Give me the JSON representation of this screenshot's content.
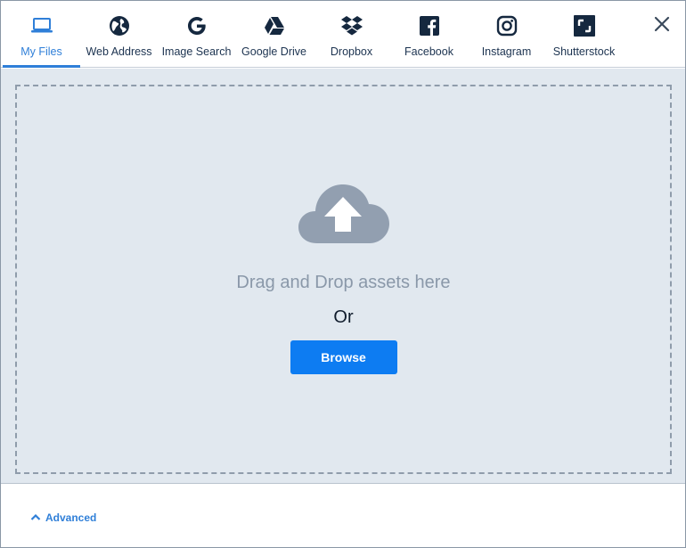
{
  "tabs": [
    {
      "id": "my-files",
      "label": "My Files",
      "icon": "laptop-icon",
      "active": true
    },
    {
      "id": "web-address",
      "label": "Web Address",
      "icon": "globe-icon",
      "active": false
    },
    {
      "id": "image-search",
      "label": "Image Search",
      "icon": "google-icon",
      "active": false
    },
    {
      "id": "google-drive",
      "label": "Google Drive",
      "icon": "google-drive-icon",
      "active": false
    },
    {
      "id": "dropbox",
      "label": "Dropbox",
      "icon": "dropbox-icon",
      "active": false
    },
    {
      "id": "facebook",
      "label": "Facebook",
      "icon": "facebook-icon",
      "active": false
    },
    {
      "id": "instagram",
      "label": "Instagram",
      "icon": "instagram-icon",
      "active": false
    },
    {
      "id": "shutterstock",
      "label": "Shutterstock",
      "icon": "shutterstock-icon",
      "active": false
    }
  ],
  "dropzone": {
    "icon": "cloud-upload-icon",
    "prompt": "Drag and Drop assets here",
    "or_text": "Or",
    "browse_label": "Browse"
  },
  "footer": {
    "advanced_label": "Advanced",
    "advanced_icon": "chevron-up-icon"
  },
  "colors": {
    "accent": "#2f7fd8",
    "primary_button": "#0d7cf2",
    "icon_dark": "#15283f",
    "dropzone_bg": "#e1e8ef",
    "cloud": "#929fb0"
  }
}
